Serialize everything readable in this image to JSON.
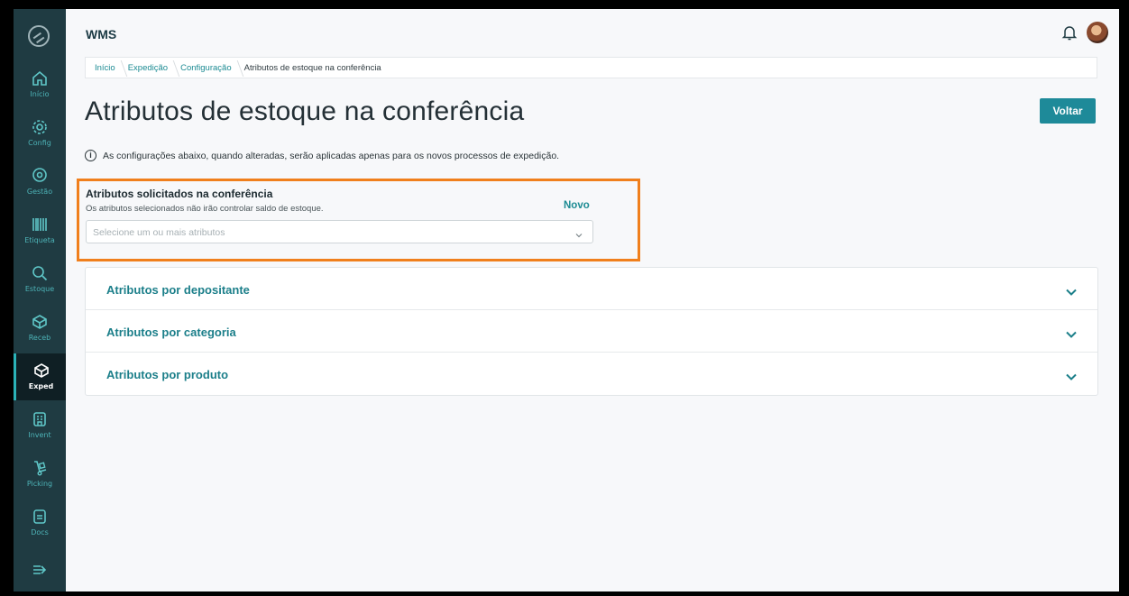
{
  "app": {
    "title": "WMS"
  },
  "sidebar": {
    "items": [
      {
        "label": "Início",
        "icon": "home-icon"
      },
      {
        "label": "Config",
        "icon": "gear-icon"
      },
      {
        "label": "Gestão",
        "icon": "location-pin-icon"
      },
      {
        "label": "Etiqueta",
        "icon": "barcode-icon"
      },
      {
        "label": "Estoque",
        "icon": "search-icon"
      },
      {
        "label": "Receb",
        "icon": "box-icon"
      },
      {
        "label": "Exped",
        "icon": "box-icon"
      },
      {
        "label": "Invent",
        "icon": "building-icon"
      },
      {
        "label": "Picking",
        "icon": "hand-truck-icon"
      },
      {
        "label": "Docs",
        "icon": "document-icon"
      }
    ],
    "active": "Exped",
    "colors": {
      "background": "#1f3b42",
      "accent": "#4db3b7"
    }
  },
  "breadcrumb": [
    "Início",
    "Expedição",
    "Configuração",
    "Atributos de estoque na conferência"
  ],
  "page": {
    "title": "Atributos de estoque na conferência",
    "back_button": "Voltar",
    "info_text": "As configurações abaixo, quando alteradas, serão aplicadas apenas para os novos processos de expedição."
  },
  "attributes_section": {
    "title": "Atributos solicitados na conferência",
    "subtitle": "Os atributos selecionados não irão controlar saldo de estoque.",
    "new_link": "Novo",
    "select_placeholder": "Selecione um ou mais atributos",
    "highlight_color": "#f07f1c"
  },
  "accordion": [
    {
      "label": "Atributos por depositante"
    },
    {
      "label": "Atributos por categoria"
    },
    {
      "label": "Atributos por produto"
    }
  ],
  "colors": {
    "primary": "#1e8a99",
    "link": "#1c8b93"
  }
}
